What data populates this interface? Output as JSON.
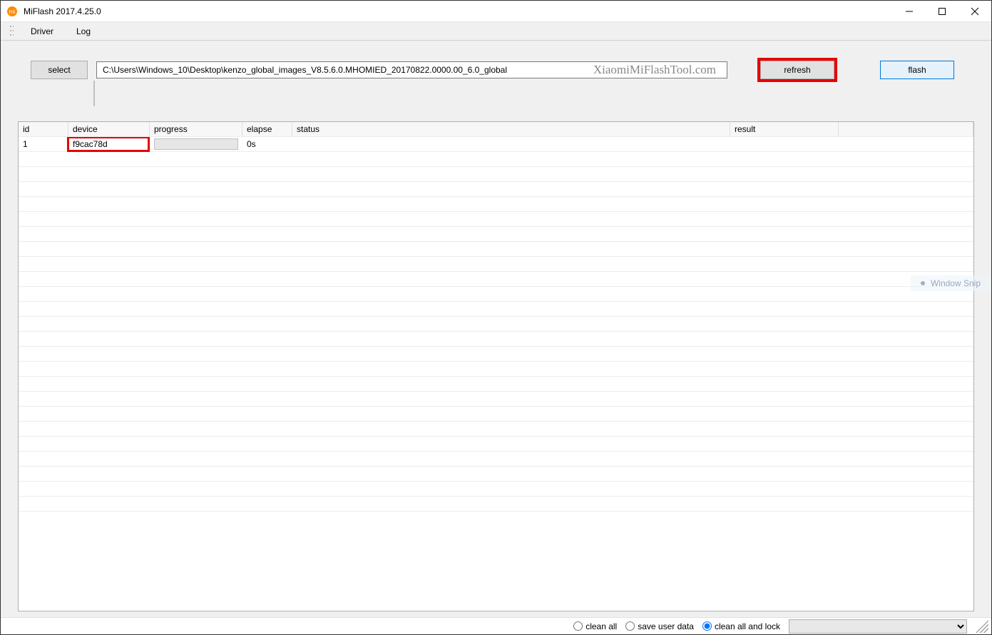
{
  "window": {
    "title": "MiFlash 2017.4.25.0"
  },
  "menubar": {
    "items": [
      "Driver",
      "Log"
    ]
  },
  "toolbar": {
    "select_label": "select",
    "refresh_label": "refresh",
    "flash_label": "flash",
    "path_value": "C:\\Users\\Windows_10\\Desktop\\kenzo_global_images_V8.5.6.0.MHOMIED_20170822.0000.00_6.0_global",
    "watermark": "XiaomiMiFlashTool.com"
  },
  "table": {
    "columns": [
      "id",
      "device",
      "progress",
      "elapse",
      "status",
      "result",
      ""
    ],
    "rows": [
      {
        "id": "1",
        "device": "f9cac78d",
        "progress": "",
        "elapse": "0s",
        "status": "",
        "result": ""
      }
    ],
    "empty_row_count": 24
  },
  "statusbar": {
    "options": [
      "clean all",
      "save user data",
      "clean all and lock"
    ],
    "selected_index": 2,
    "combo_value": ""
  },
  "overlay": {
    "window_snip": "Window Snip"
  }
}
